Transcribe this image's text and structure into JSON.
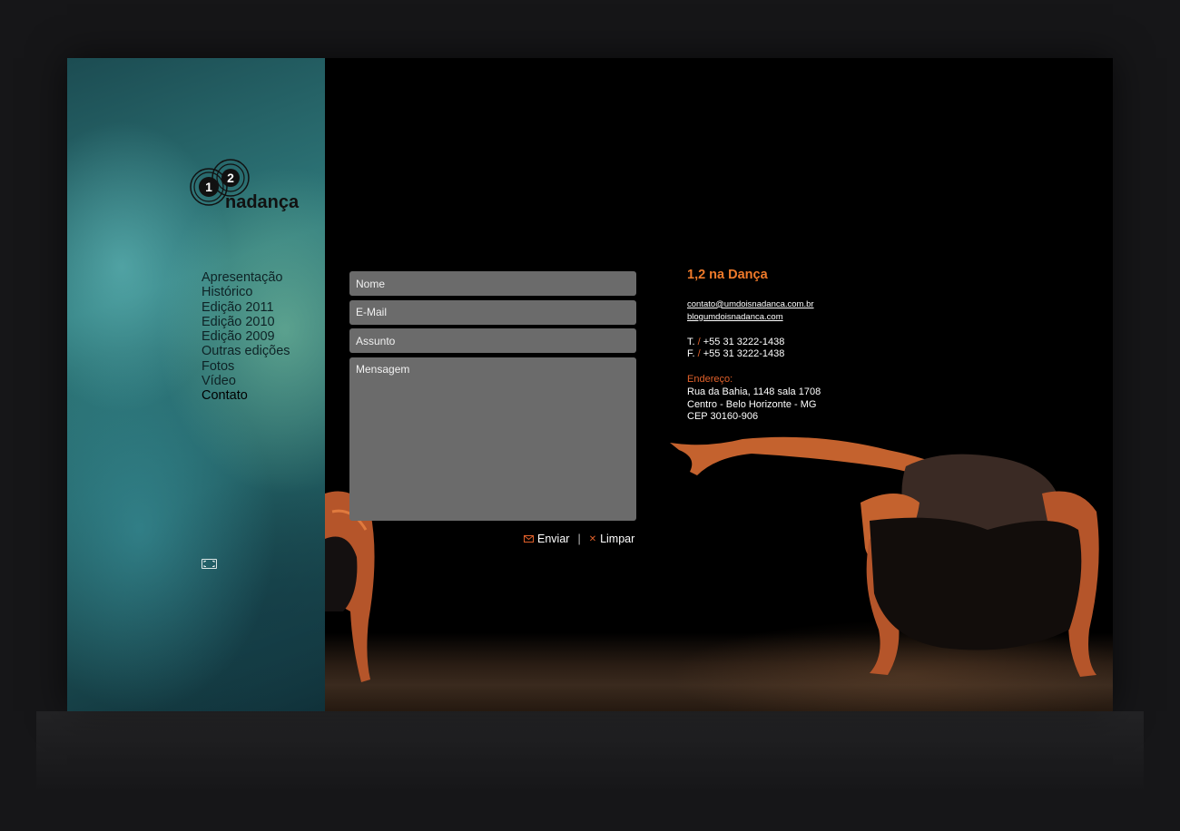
{
  "logo": {
    "numbers": [
      "1",
      "2"
    ],
    "wordmark": "nadança"
  },
  "nav": {
    "items": [
      {
        "label": "Apresentação"
      },
      {
        "label": "Histórico"
      },
      {
        "label": "Edição 2011"
      },
      {
        "label": "Edição 2010"
      },
      {
        "label": "Edição 2009"
      },
      {
        "label": "Outras edições"
      },
      {
        "label": "Fotos"
      },
      {
        "label": "Vídeo"
      },
      {
        "label": "Contato",
        "active": true
      }
    ]
  },
  "form": {
    "name_placeholder": "Nome",
    "email_placeholder": "E-Mail",
    "subject_placeholder": "Assunto",
    "message_placeholder": "Mensagem",
    "send_label": "Enviar",
    "separator": "|",
    "clear_label": "Limpar"
  },
  "contact": {
    "title": "1,2 na Dança",
    "email": "contato@umdoisnadanca.com.br",
    "blog": "blogumdoisnadanca.com",
    "phone_prefix": "T.",
    "phone": "+55 31 3222-1438",
    "fax_prefix": "F.",
    "fax": "+55 31 3222-1438",
    "slash": "/",
    "address_label": "Endereço:",
    "address_lines": [
      "Rua da Bahia, 1148 sala 1708",
      "Centro - Belo Horizonte - MG",
      "CEP 30160-906"
    ]
  },
  "colors": {
    "accent": "#f07a2a",
    "field_bg": "#6b6b6b",
    "page_bg": "#161618"
  }
}
